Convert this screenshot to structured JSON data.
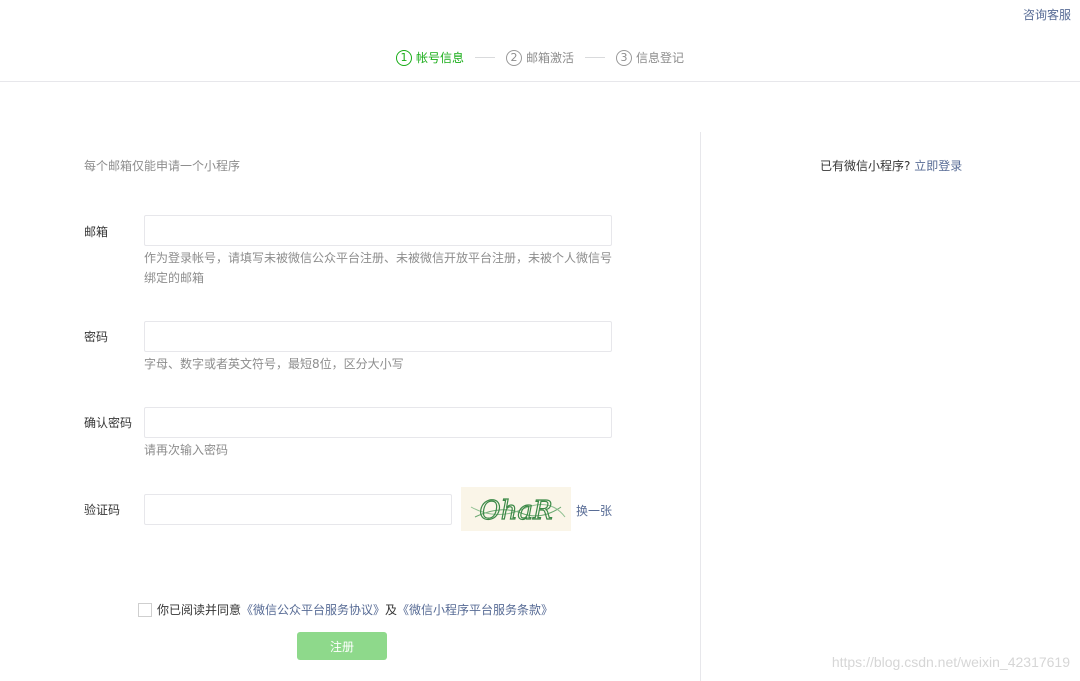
{
  "header": {
    "service_link": "咨询客服",
    "steps": [
      {
        "num": "1",
        "label": "帐号信息",
        "active": true
      },
      {
        "num": "2",
        "label": "邮箱激活",
        "active": false
      },
      {
        "num": "3",
        "label": "信息登记",
        "active": false
      }
    ]
  },
  "form": {
    "note": "每个邮箱仅能申请一个小程序",
    "email": {
      "label": "邮箱",
      "value": "",
      "tip": "作为登录帐号，请填写未被微信公众平台注册、未被微信开放平台注册，未被个人微信号绑定的邮箱"
    },
    "password": {
      "label": "密码",
      "value": "",
      "tip": "字母、数字或者英文符号，最短8位，区分大小写"
    },
    "confirm": {
      "label": "确认密码",
      "value": "",
      "tip": "请再次输入密码"
    },
    "captcha": {
      "label": "验证码",
      "value": "",
      "image_text": "OhaR",
      "change_label": "换一张"
    },
    "agreement": {
      "text_before": "你已阅读并同意",
      "link1": "《微信公众平台服务协议》",
      "and": "及",
      "link2": "《微信小程序平台服务条款》",
      "checked": false
    },
    "submit_label": "注册"
  },
  "side": {
    "question": "已有微信小程序?",
    "login_link": "立即登录"
  },
  "watermark": "https://blog.csdn.net/weixin_42317619",
  "colors": {
    "accent": "#1aad19",
    "link": "#576b95",
    "button": "#8ed98b"
  }
}
